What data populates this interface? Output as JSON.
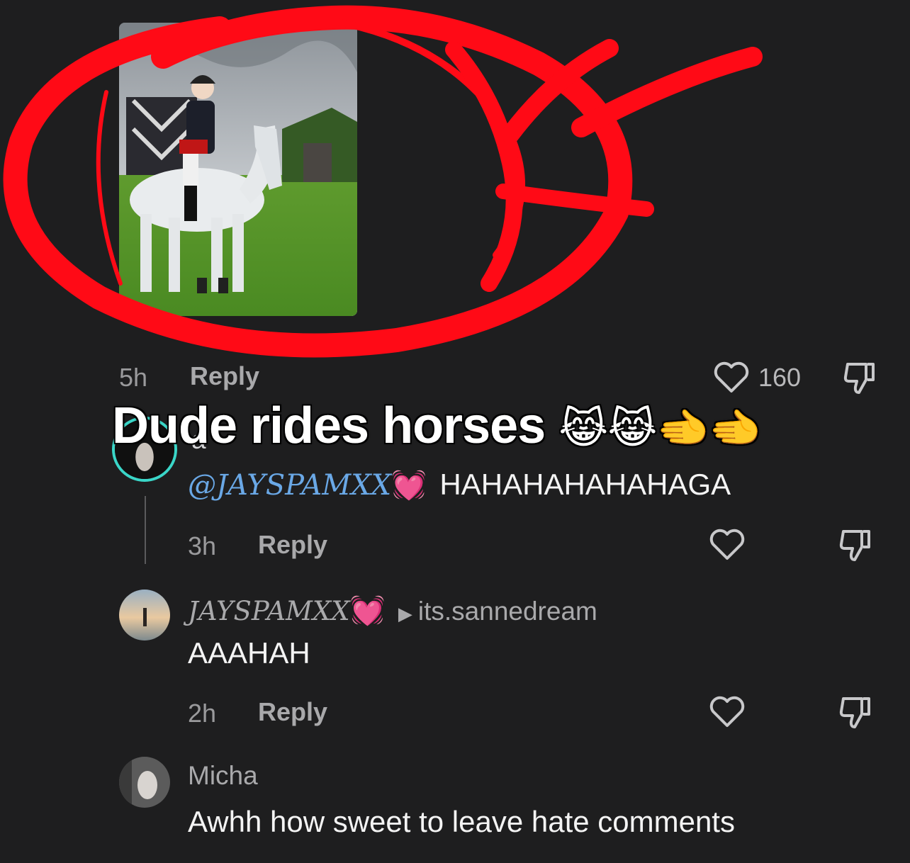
{
  "top_comment": {
    "time": "5h",
    "reply_label": "Reply",
    "like_count": "160"
  },
  "caption": {
    "text": "Dude rides horses",
    "emoji": "😹😹🫲🫲"
  },
  "reply_1": {
    "mention": "@JAYSPAMXX",
    "mention_emoji": "💓",
    "text": "HAHAHAHAHAHAGA",
    "time": "3h",
    "reply_label": "Reply"
  },
  "reply_2": {
    "username": "JAYSPAMXX",
    "username_emoji": "💓",
    "reply_to": "its.sannedream",
    "text": "AAAHAH",
    "time": "2h",
    "reply_label": "Reply"
  },
  "reply_3": {
    "username": "Micha",
    "text": "Awhh how sweet to leave hate comments"
  },
  "colors": {
    "background": "#1e1e1f",
    "mention": "#6aa8e6",
    "scribble": "#ff0a16",
    "avatar_ring": "#3ad6c8"
  },
  "icons": [
    "heart-icon",
    "dislike-icon",
    "play-triangle-icon"
  ]
}
